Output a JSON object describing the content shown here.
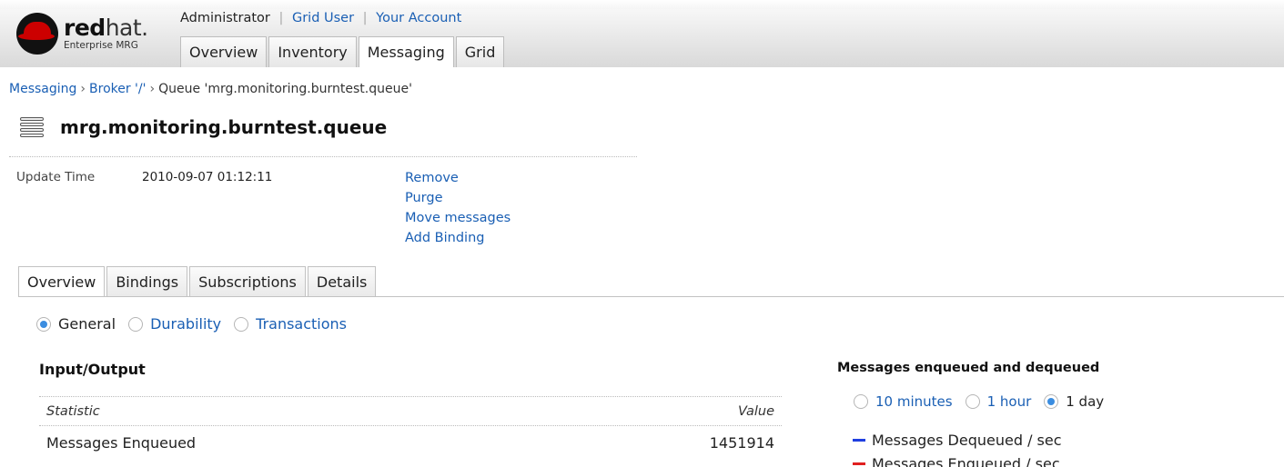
{
  "brand": {
    "name_bold": "red",
    "name_light": "hat.",
    "product": "Enterprise MRG"
  },
  "user_bar": {
    "user": "Administrator",
    "links": [
      "Grid User",
      "Your Account"
    ]
  },
  "top_nav": {
    "tabs": [
      "Overview",
      "Inventory",
      "Messaging",
      "Grid"
    ],
    "active": "Messaging"
  },
  "breadcrumb": {
    "items": [
      "Messaging",
      "Broker '/'"
    ],
    "current": "Queue 'mrg.monitoring.burntest.queue'",
    "separator": "›"
  },
  "page": {
    "title": "mrg.monitoring.burntest.queue",
    "icon": "queue-stack-icon"
  },
  "properties": {
    "update_time_label": "Update Time",
    "update_time_value": "2010-09-07 01:12:11"
  },
  "actions": [
    "Remove",
    "Purge",
    "Move messages",
    "Add Binding"
  ],
  "sub_tabs": {
    "tabs": [
      "Overview",
      "Bindings",
      "Subscriptions",
      "Details"
    ],
    "active": "Overview"
  },
  "view_options": {
    "options": [
      "General",
      "Durability",
      "Transactions"
    ],
    "selected": "General"
  },
  "io_section": {
    "heading": "Input/Output",
    "columns": [
      "Statistic",
      "Value"
    ],
    "rows": [
      {
        "statistic": "Messages Enqueued",
        "value": "1451914"
      }
    ]
  },
  "chart_panel": {
    "title": "Messages enqueued and dequeued",
    "ranges": [
      "10 minutes",
      "1 hour",
      "1 day"
    ],
    "selected": "1 day",
    "legend": [
      {
        "label": "Messages Dequeued / sec",
        "color": "#1f3fe0"
      },
      {
        "label": "Messages Enqueued / sec",
        "color": "#e02020"
      }
    ]
  },
  "colors": {
    "link": "#1a5fb4",
    "radio_selected": "#3b8de0"
  }
}
